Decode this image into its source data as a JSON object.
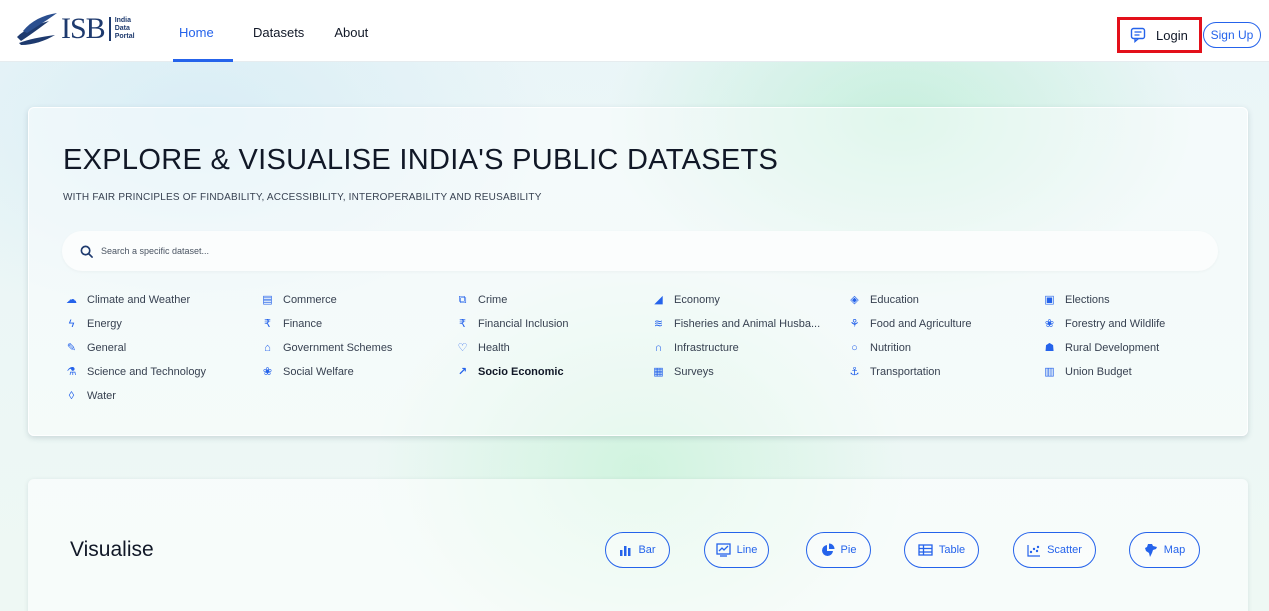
{
  "header": {
    "logo_text": "ISB",
    "logo_sub": [
      "India",
      "Data",
      "Portal"
    ],
    "nav": [
      {
        "label": "Home",
        "active": true
      },
      {
        "label": "Datasets",
        "active": false
      },
      {
        "label": "About",
        "active": false
      }
    ],
    "login_label": "Login",
    "signup_label": "Sign Up",
    "login_highlight_color": "#e3101a",
    "accent_color": "#2563eb"
  },
  "hero": {
    "title": "EXPLORE & VISUALISE INDIA'S PUBLIC DATASETS",
    "subtitle": "WITH FAIR PRINCIPLES OF FINDABILITY, ACCESSIBILITY, INTEROPERABILITY AND REUSABILITY",
    "search_placeholder": "Search a specific dataset...",
    "categories": [
      {
        "label": "Climate and Weather",
        "icon": "cloud-sun-icon"
      },
      {
        "label": "Commerce",
        "icon": "store-icon"
      },
      {
        "label": "Crime",
        "icon": "handcuff-icon"
      },
      {
        "label": "Economy",
        "icon": "growth-icon"
      },
      {
        "label": "Education",
        "icon": "graduation-icon"
      },
      {
        "label": "Elections",
        "icon": "ballot-icon"
      },
      {
        "label": "Energy",
        "icon": "bolt-icon"
      },
      {
        "label": "Finance",
        "icon": "rupee-icon"
      },
      {
        "label": "Financial Inclusion",
        "icon": "rupee-icon"
      },
      {
        "label": "Fisheries and Animal Husba...",
        "icon": "fish-icon"
      },
      {
        "label": "Food and Agriculture",
        "icon": "wheat-icon"
      },
      {
        "label": "Forestry and Wildlife",
        "icon": "paw-icon"
      },
      {
        "label": "General",
        "icon": "edit-icon"
      },
      {
        "label": "Government Schemes",
        "icon": "government-icon"
      },
      {
        "label": "Health",
        "icon": "heart-pulse-icon"
      },
      {
        "label": "Infrastructure",
        "icon": "bridge-icon"
      },
      {
        "label": "Nutrition",
        "icon": "apple-icon"
      },
      {
        "label": "Rural Development",
        "icon": "village-icon"
      },
      {
        "label": "Science and Technology",
        "icon": "flask-icon"
      },
      {
        "label": "Social Welfare",
        "icon": "hands-icon"
      },
      {
        "label": "Socio Economic",
        "icon": "chart-line-icon",
        "bold": true
      },
      {
        "label": "Surveys",
        "icon": "map-icon"
      },
      {
        "label": "Transportation",
        "icon": "ship-icon"
      },
      {
        "label": "Union Budget",
        "icon": "calculator-icon"
      },
      {
        "label": "Water",
        "icon": "drop-icon"
      }
    ]
  },
  "visualise": {
    "title": "Visualise",
    "buttons": [
      {
        "label": "Bar",
        "icon": "bar-chart-icon"
      },
      {
        "label": "Line",
        "icon": "line-chart-icon"
      },
      {
        "label": "Pie",
        "icon": "pie-chart-icon"
      },
      {
        "label": "Table",
        "icon": "table-icon"
      },
      {
        "label": "Scatter",
        "icon": "scatter-chart-icon"
      },
      {
        "label": "Map",
        "icon": "india-map-icon"
      }
    ]
  }
}
